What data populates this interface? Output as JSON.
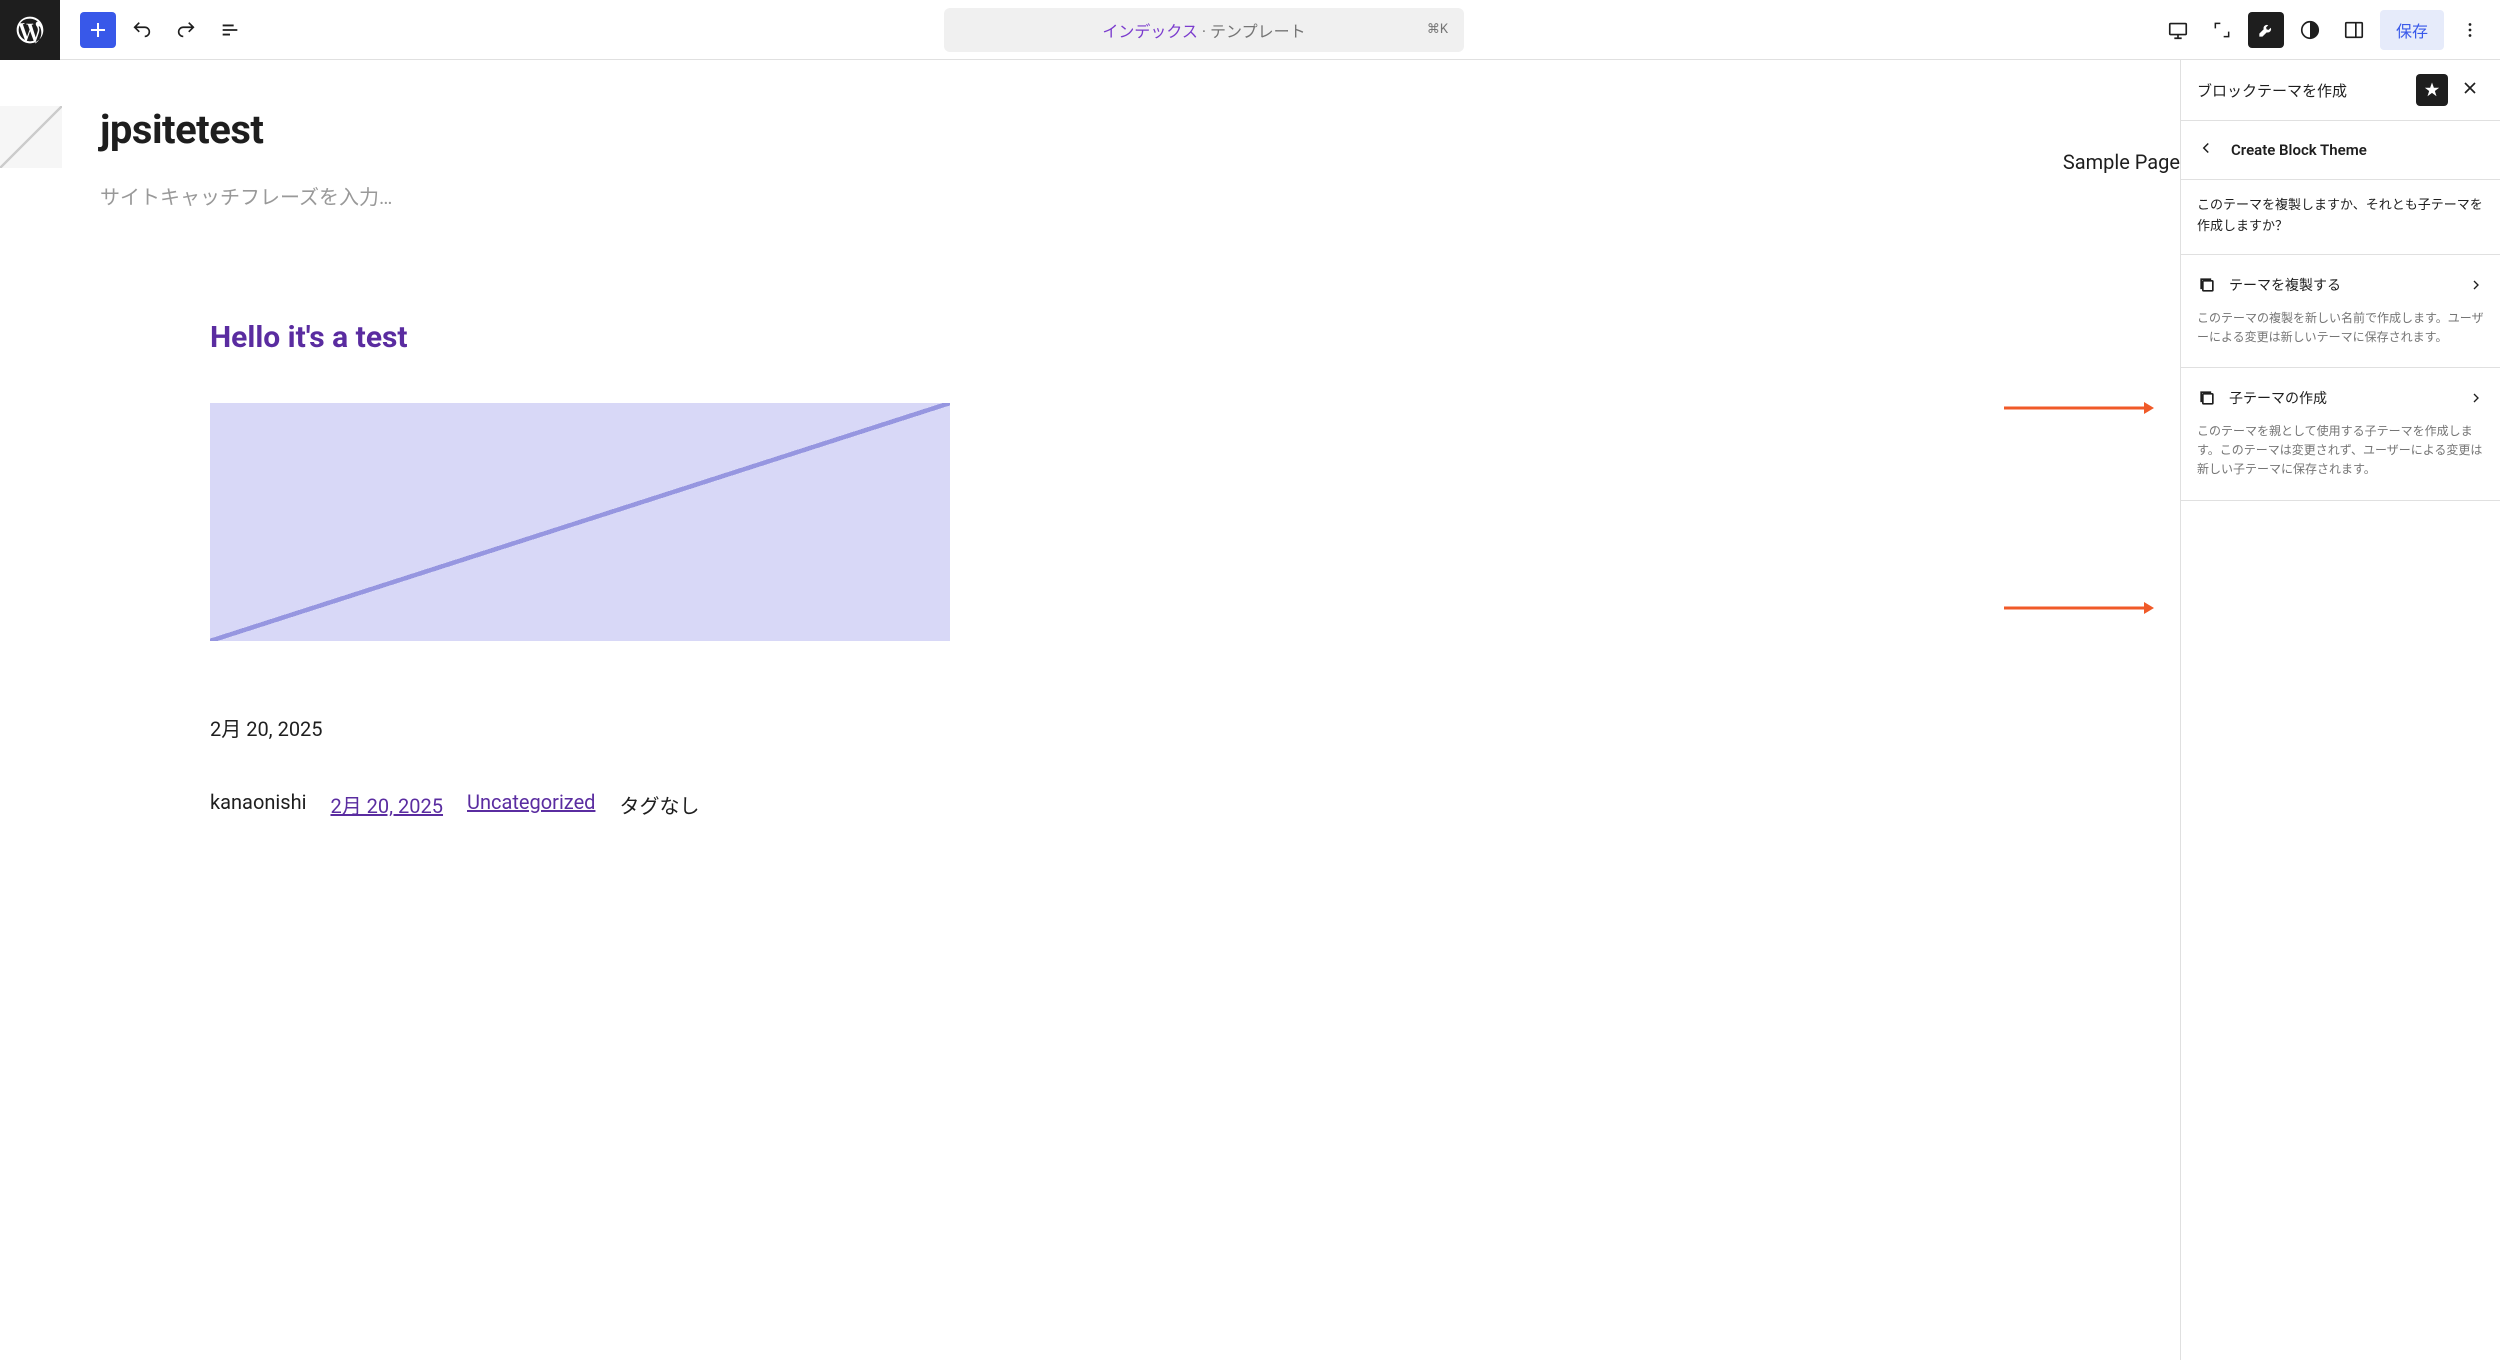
{
  "toolbar": {
    "document_link": "インデックス",
    "document_separator": " · テンプレート",
    "shortcut": "⌘K",
    "save_label": "保存"
  },
  "canvas": {
    "site_title": "jpsitetest",
    "tagline_placeholder": "サイトキャッチフレーズを入力…",
    "nav_item": "Sample Page",
    "post_title": "Hello it's a test",
    "post_date": "2月 20, 2025",
    "meta": {
      "author": "kanaonishi",
      "date_link": "2月 20, 2025",
      "category": "Uncategorized",
      "tags": "タグなし"
    }
  },
  "sidebar": {
    "title": "ブロックテーマを作成",
    "panel_title": "Create Block Theme",
    "question": "このテーマを複製しますか、それとも子テーマを作成しますか？",
    "options": [
      {
        "label": "テーマを複製する",
        "desc": "このテーマの複製を新しい名前で作成します。ユーザーによる変更は新しいテーマに保存されます。"
      },
      {
        "label": "子テーマの作成",
        "desc": "このテーマを親として使用する子テーマを作成します。このテーマは変更されず、ユーザーによる変更は新しい子テーマに保存されます。"
      }
    ]
  }
}
